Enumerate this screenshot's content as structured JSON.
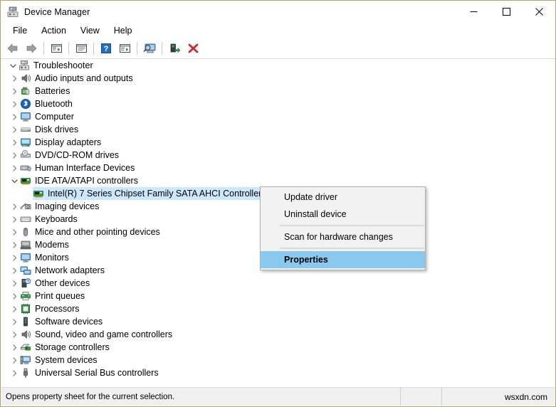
{
  "window": {
    "title": "Device Manager",
    "icon": "device-manager-icon",
    "controls": {
      "minimize": "—",
      "maximize": "□",
      "close": "✕"
    }
  },
  "menubar": {
    "items": [
      {
        "label": "File"
      },
      {
        "label": "Action"
      },
      {
        "label": "View"
      },
      {
        "label": "Help"
      }
    ]
  },
  "toolbar": {
    "buttons": [
      {
        "name": "back-icon"
      },
      {
        "name": "forward-icon"
      },
      {
        "name": "separator"
      },
      {
        "name": "properties-icon"
      },
      {
        "name": "separator"
      },
      {
        "name": "update-driver-icon"
      },
      {
        "name": "separator"
      },
      {
        "name": "help-icon"
      },
      {
        "name": "scan-hardware-icon"
      },
      {
        "name": "separator"
      },
      {
        "name": "show-hidden-devices-icon"
      },
      {
        "name": "separator"
      },
      {
        "name": "enable-device-icon"
      },
      {
        "name": "uninstall-device-icon"
      }
    ]
  },
  "tree": {
    "root": {
      "label": "Troubleshooter",
      "icon": "computer-root-icon",
      "expanded": true,
      "chevron": "chevron-down-icon"
    },
    "items": [
      {
        "label": "Audio inputs and outputs",
        "icon": "speaker-icon",
        "expanded": false,
        "level": 1
      },
      {
        "label": "Batteries",
        "icon": "battery-icon",
        "expanded": false,
        "level": 1
      },
      {
        "label": "Bluetooth",
        "icon": "bluetooth-icon",
        "expanded": false,
        "level": 1
      },
      {
        "label": "Computer",
        "icon": "monitor-icon",
        "expanded": false,
        "level": 1
      },
      {
        "label": "Disk drives",
        "icon": "disk-drive-icon",
        "expanded": false,
        "level": 1
      },
      {
        "label": "Display adapters",
        "icon": "display-adapter-icon",
        "expanded": false,
        "level": 1
      },
      {
        "label": "DVD/CD-ROM drives",
        "icon": "optical-drive-icon",
        "expanded": false,
        "level": 1
      },
      {
        "label": "Human Interface Devices",
        "icon": "hid-icon",
        "expanded": false,
        "level": 1
      },
      {
        "label": "IDE ATA/ATAPI controllers",
        "icon": "controller-card-icon",
        "expanded": true,
        "level": 1
      },
      {
        "label": "Intel(R) 7 Series Chipset Family SATA AHCI Controller",
        "icon": "controller-card-icon",
        "expanded": null,
        "level": 2,
        "selected": true
      },
      {
        "label": "Imaging devices",
        "icon": "imaging-device-icon",
        "expanded": false,
        "level": 1
      },
      {
        "label": "Keyboards",
        "icon": "keyboard-icon",
        "expanded": false,
        "level": 1
      },
      {
        "label": "Mice and other pointing devices",
        "icon": "mouse-icon",
        "expanded": false,
        "level": 1
      },
      {
        "label": "Modems",
        "icon": "modem-icon",
        "expanded": false,
        "level": 1
      },
      {
        "label": "Monitors",
        "icon": "monitor-icon",
        "expanded": false,
        "level": 1
      },
      {
        "label": "Network adapters",
        "icon": "network-adapter-icon",
        "expanded": false,
        "level": 1
      },
      {
        "label": "Other devices",
        "icon": "other-device-icon",
        "expanded": false,
        "level": 1
      },
      {
        "label": "Print queues",
        "icon": "printer-icon",
        "expanded": false,
        "level": 1
      },
      {
        "label": "Processors",
        "icon": "processor-icon",
        "expanded": false,
        "level": 1
      },
      {
        "label": "Software devices",
        "icon": "software-device-icon",
        "expanded": false,
        "level": 1
      },
      {
        "label": "Sound, video and game controllers",
        "icon": "speaker-icon",
        "expanded": false,
        "level": 1
      },
      {
        "label": "Storage controllers",
        "icon": "storage-controller-icon",
        "expanded": false,
        "level": 1
      },
      {
        "label": "System devices",
        "icon": "system-device-icon",
        "expanded": false,
        "level": 1
      },
      {
        "label": "Universal Serial Bus controllers",
        "icon": "usb-icon",
        "expanded": false,
        "level": 1
      }
    ]
  },
  "context_menu": {
    "items": [
      {
        "label": "Update driver",
        "type": "item",
        "highlight": false
      },
      {
        "label": "Uninstall device",
        "type": "item",
        "highlight": false
      },
      {
        "type": "separator"
      },
      {
        "label": "Scan for hardware changes",
        "type": "item",
        "highlight": false
      },
      {
        "type": "separator"
      },
      {
        "label": "Properties",
        "type": "item",
        "highlight": true
      }
    ]
  },
  "statusbar": {
    "message": "Opens property sheet for the current selection.",
    "middle": "",
    "watermark": "wsxdn.com"
  },
  "colors": {
    "window_border": "#b4a269",
    "selection": "#cce8ff",
    "menu_highlight": "#89c9f0",
    "statusbar_bg": "#f0f0f0"
  }
}
